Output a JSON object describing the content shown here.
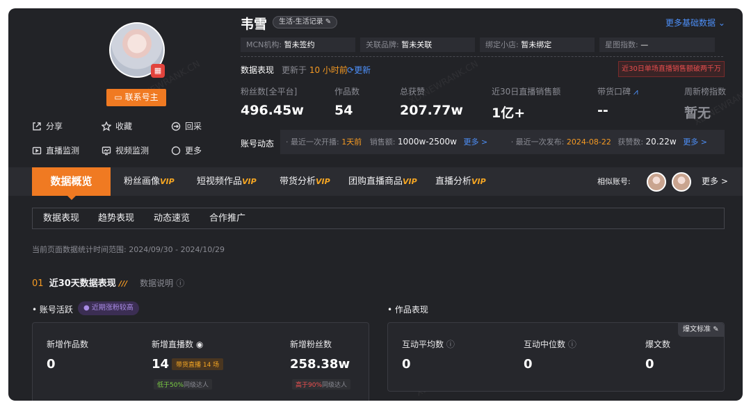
{
  "profile": {
    "contact_label": "联系号主",
    "actions": [
      "分享",
      "收藏",
      "回采",
      "直播监测",
      "视频监测",
      "更多"
    ]
  },
  "header": {
    "name": "韦雪",
    "tag": "生活-生活记录",
    "more_basic": "更多基础数据",
    "info": [
      {
        "label": "MCN机构:",
        "value": "暂未签约"
      },
      {
        "label": "关联品牌:",
        "value": "暂未关联"
      },
      {
        "label": "绑定小店:",
        "value": "暂未绑定"
      },
      {
        "label": "星图指数:",
        "value": "—"
      }
    ]
  },
  "performance": {
    "title": "数据表现",
    "updated_prefix": "更新于",
    "updated_value": "10 小时前",
    "refresh": "更新",
    "warning": "近30日单场直播销售额破两千万",
    "kpis": [
      {
        "label": "粉丝数[全平台]",
        "value": "496.45w"
      },
      {
        "label": "作品数",
        "value": "54"
      },
      {
        "label": "总获赞",
        "value": "207.77w"
      },
      {
        "label": "近30日直播销售额",
        "value": "1亿+"
      },
      {
        "label": "带货口碑",
        "value": "--"
      },
      {
        "label": "周新榜指数",
        "value": "暂无"
      }
    ]
  },
  "feed": {
    "title": "账号动态",
    "live_label": "· 最近一次开播:",
    "live_value": "1天前",
    "sales_label": "销售额:",
    "sales_value": "1000w-2500w",
    "more1": "更多 >",
    "post_label": "· 最近一次发布:",
    "post_value": "2024-08-22",
    "likes_label": "获赞数:",
    "likes_value": "20.22w",
    "more2": "更多 >"
  },
  "tabs": {
    "active": "数据概览",
    "items": [
      "粉丝画像",
      "短视频作品",
      "带货分析",
      "团购直播商品",
      "直播分析"
    ],
    "vip": "VIP",
    "similar_label": "相似账号:",
    "similar_more": "更多 >"
  },
  "subtabs": [
    "数据表现",
    "趋势表现",
    "动态速览",
    "合作推广"
  ],
  "range_text": "当前页面数据统计时间范围: 2024/09/30 - 2024/10/29",
  "section": {
    "num": "01",
    "title": "近30天数据表现",
    "explain": "数据说明"
  },
  "activity": {
    "title": "账号活跃",
    "badge": "近期涨粉较高",
    "metrics": [
      {
        "label": "新增作品数",
        "value": "0"
      },
      {
        "label": "新增直播数",
        "value": "14",
        "pill": "带货直播 14 场",
        "note_hl": "低于50%",
        "note": "同级达人"
      },
      {
        "label": "新增粉丝数",
        "value": "258.38w",
        "note_hl": "高于90%",
        "note": "同级达人"
      }
    ]
  },
  "works": {
    "title": "作品表现",
    "standard": "爆文标准",
    "metrics": [
      {
        "label": "互动平均数",
        "value": "0"
      },
      {
        "label": "互动中位数",
        "value": "0"
      },
      {
        "label": "爆文数",
        "value": "0"
      }
    ]
  },
  "watermark": "XD.NEWRANK.CN"
}
